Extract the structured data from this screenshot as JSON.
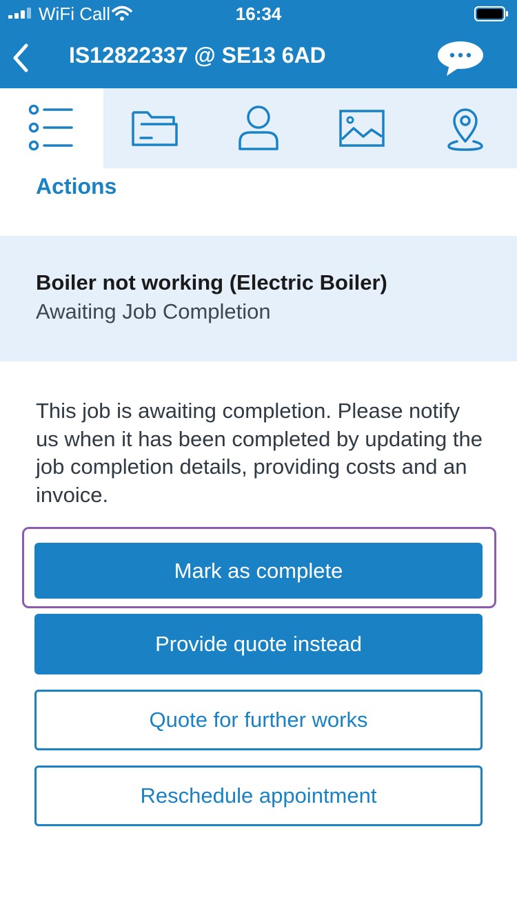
{
  "status_bar": {
    "carrier": "WiFi Call",
    "time": "16:34"
  },
  "header": {
    "title": "IS12822337 @ SE13 6AD",
    "background_color": "#1a82c4"
  },
  "tabs": [
    {
      "icon": "list-icon",
      "active": true
    },
    {
      "icon": "folder-icon",
      "active": false
    },
    {
      "icon": "person-icon",
      "active": false
    },
    {
      "icon": "image-icon",
      "active": false
    },
    {
      "icon": "location-pin-icon",
      "active": false
    }
  ],
  "main": {
    "section_title": "Actions",
    "job": {
      "name": "Boiler not working (Electric Boiler)",
      "status": "Awaiting Job Completion"
    },
    "description": "This job is awaiting completion. Please notify us when it has been completed by updating the job completion details, providing costs and an invoice.",
    "buttons": {
      "mark_complete": "Mark as complete",
      "provide_quote": "Provide quote instead",
      "quote_further": "Quote for further works",
      "reschedule": "Reschedule appointment"
    }
  },
  "colors": {
    "accent": "#1a82c4",
    "tab_background": "#e6f0fa",
    "highlight_outline": "#8a5bae"
  }
}
